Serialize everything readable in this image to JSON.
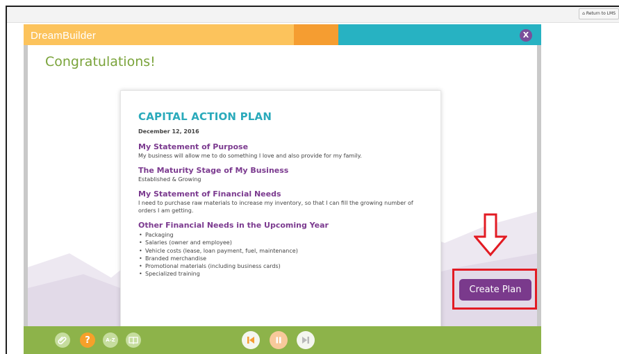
{
  "browser": {
    "return_label": "Return to LMS"
  },
  "app": {
    "logo": "DreamBuilder",
    "close_label": "X"
  },
  "page": {
    "title": "Congratulations!"
  },
  "document": {
    "title": "CAPITAL ACTION PLAN",
    "date": "December 12, 2016",
    "sections": [
      {
        "heading": "My Statement of Purpose",
        "text": "My business will allow me to do something I love and also provide for my family."
      },
      {
        "heading": "The Maturity Stage of My Business",
        "text": "Established & Growing"
      },
      {
        "heading": "My Statement of Financial Needs",
        "text": "I need to purchase raw materials to increase my inventory, so that I can fill the growing number of orders I am getting."
      },
      {
        "heading": "Other Financial Needs in the Upcoming Year",
        "items": [
          "Packaging",
          "Salaries (owner and employee)",
          "Vehicle costs (lease, loan payment, fuel, maintenance)",
          "Branded merchandise",
          "Promotional materials (including business cards)",
          "Specialized training"
        ]
      }
    ]
  },
  "actions": {
    "create_plan_label": "Create Plan"
  },
  "footer": {
    "help_label": "?",
    "glossary_label": "A-Z",
    "tools": [
      "paperclip-icon",
      "help-icon",
      "glossary-icon",
      "book-icon"
    ],
    "media": [
      "previous-icon",
      "pause-icon",
      "next-icon"
    ]
  },
  "colors": {
    "header_yellow": "#fcc35c",
    "header_orange": "#f59d31",
    "header_teal": "#27b2c2",
    "title_green": "#7aa33a",
    "doc_title_teal": "#2aaabb",
    "heading_purple": "#7b3a8f",
    "button_purple": "#7a3a8c",
    "highlight_red": "#e21b23",
    "footer_green": "#8db34a"
  }
}
